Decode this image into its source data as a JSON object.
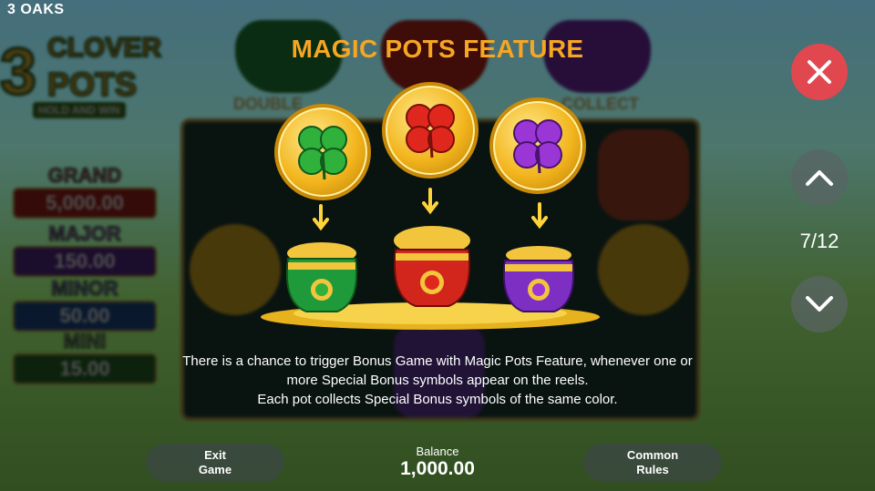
{
  "brand": "3 OAKS",
  "game_logo": {
    "number": "3",
    "line1": "CLOVER",
    "line2": "POTS",
    "tagline": "HOLD AND WIN"
  },
  "jackpots": [
    {
      "name": "GRAND",
      "value": "5,000.00",
      "color": "#d23b2f"
    },
    {
      "name": "MAJOR",
      "value": "150.00",
      "color": "#7a3bb8"
    },
    {
      "name": "MINOR",
      "value": "50.00",
      "color": "#2b6fc1"
    },
    {
      "name": "MINI",
      "value": "15.00",
      "color": "#3a9a3a"
    }
  ],
  "reel_labels": {
    "double": "DOUBLE",
    "collect": "COLLECT"
  },
  "info": {
    "title": "MAGIC POTS FEATURE",
    "pots": [
      {
        "color": "green",
        "hex": "#2fb13c"
      },
      {
        "color": "red",
        "hex": "#e0271d"
      },
      {
        "color": "purple",
        "hex": "#9b36d6"
      }
    ],
    "description": [
      "There is a chance to trigger Bonus Game with Magic Pots Feature, whenever one or",
      "more Special Bonus symbols appear on the reels.",
      "Each pot collects Special Bonus symbols of the same color."
    ]
  },
  "navigation": {
    "page": "7/12",
    "close_icon": "close-icon",
    "up_icon": "chevron-up-icon",
    "down_icon": "chevron-down-icon"
  },
  "footer": {
    "exit_line1": "Exit",
    "exit_line2": "Game",
    "balance_label": "Balance",
    "balance_value": "1,000.00",
    "rules_line1": "Common",
    "rules_line2": "Rules"
  }
}
